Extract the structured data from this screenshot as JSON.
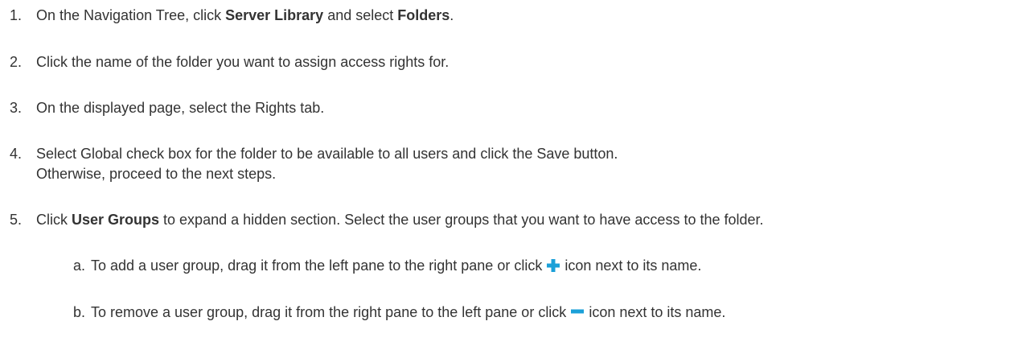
{
  "steps": [
    {
      "number": "1.",
      "t1": "On the Navigation Tree, click ",
      "b1": "Server Library",
      "t2": " and select ",
      "b2": "Folders",
      "t3": "."
    },
    {
      "number": "2.",
      "text": "Click the name of the folder you want to assign access rights for."
    },
    {
      "number": "3.",
      "text": "On the displayed page, select the Rights tab."
    },
    {
      "number": "4.",
      "text": "Select Global check box for the folder to be available to all users and click the Save button.",
      "continuation": "Otherwise, proceed to the next steps."
    },
    {
      "number": "5.",
      "b1": "User Groups",
      "t1": " Click ",
      "t2": " to expand a hidden section. Select the user groups that you want to have access to the folder."
    }
  ],
  "substeps": [
    {
      "letter": "a.",
      "before_icon": "To add a user group, drag it from the left pane to the right pane or click ",
      "icon": "plus-icon",
      "after_icon": " icon next to its name."
    },
    {
      "letter": "b.",
      "before_icon": "To remove a user group, drag it from the right pane to the left pane or click ",
      "icon": "minus-icon",
      "after_icon": " icon next to its name."
    }
  ],
  "colors": {
    "text": "#333333",
    "icon_accent": "#1ba0d8",
    "background": "#ffffff"
  }
}
